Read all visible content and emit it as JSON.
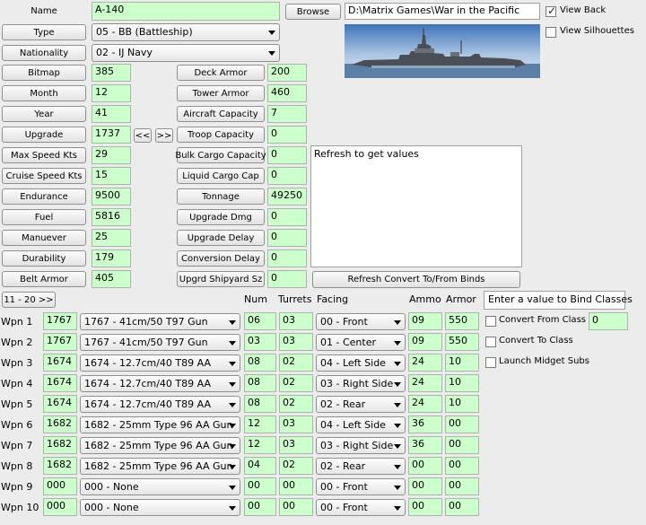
{
  "name": {
    "label": "Name",
    "value": "A-140",
    "browse": "Browse",
    "path": "D:\\Matrix Games\\War in the Pacific"
  },
  "type": {
    "label": "Type",
    "value": "05 - BB (Battleship)"
  },
  "nationality": {
    "label": "Nationality",
    "value": "02 - IJ Navy"
  },
  "view_back": {
    "label": "View Back",
    "checked": true
  },
  "view_silhouettes": {
    "label": "View Silhouettes",
    "checked": false
  },
  "left_fields": [
    {
      "label": "Bitmap",
      "value": "385"
    },
    {
      "label": "Month",
      "value": "12"
    },
    {
      "label": "Year",
      "value": "41"
    },
    {
      "label": "Upgrade",
      "value": "1737"
    },
    {
      "label": "Max Speed Kts",
      "value": "29"
    },
    {
      "label": "Cruise Speed Kts",
      "value": "15"
    },
    {
      "label": "Endurance",
      "value": "9500"
    },
    {
      "label": "Fuel",
      "value": "5816"
    },
    {
      "label": "Manuever",
      "value": "25"
    },
    {
      "label": "Durability",
      "value": "179"
    },
    {
      "label": "Belt Armor",
      "value": "405"
    }
  ],
  "upgrade_nav": {
    "prev": "<<",
    "next": ">>"
  },
  "mid_fields": [
    {
      "label": "Deck Armor",
      "value": "200"
    },
    {
      "label": "Tower Armor",
      "value": "460"
    },
    {
      "label": "Aircraft Capacity",
      "value": "7"
    },
    {
      "label": "Troop Capacity",
      "value": "0"
    },
    {
      "label": "Bulk Cargo Capacity",
      "value": "0"
    },
    {
      "label": "Liquid Cargo Cap",
      "value": "0"
    },
    {
      "label": "Tonnage",
      "value": "49250"
    },
    {
      "label": "Upgrade Dmg",
      "value": "0"
    },
    {
      "label": "Upgrade Delay",
      "value": "0"
    },
    {
      "label": "Conversion Delay",
      "value": "0"
    },
    {
      "label": "Upgrd Shipyard Sz",
      "value": "0"
    }
  ],
  "refresh_text": "Refresh to get values",
  "refresh_button": "Refresh Convert To/From Binds",
  "page_button": "11 - 20 >>",
  "headers": {
    "num": "Num",
    "turrets": "Turrets",
    "facing": "Facing",
    "ammo": "Ammo",
    "armor": "Armor"
  },
  "bind_hint": "Enter a value to Bind Classes",
  "convert_from": {
    "label": "Convert From Class",
    "value": "0"
  },
  "convert_to": {
    "label": "Convert To Class"
  },
  "launch_midget": {
    "label": "Launch Midget Subs"
  },
  "weapons": [
    {
      "label": "Wpn 1",
      "id": "1767",
      "device": "1767 - 41cm/50 T97 Gun",
      "num": "06",
      "turrets": "03",
      "facing": "00 - Front",
      "ammo": "09",
      "armor": "550"
    },
    {
      "label": "Wpn 2",
      "id": "1767",
      "device": "1767 - 41cm/50 T97 Gun",
      "num": "03",
      "turrets": "03",
      "facing": "01 - Center",
      "ammo": "09",
      "armor": "550"
    },
    {
      "label": "Wpn 3",
      "id": "1674",
      "device": "1674 - 12.7cm/40 T89 AA",
      "num": "08",
      "turrets": "02",
      "facing": "04 - Left Side",
      "ammo": "24",
      "armor": "10"
    },
    {
      "label": "Wpn 4",
      "id": "1674",
      "device": "1674 - 12.7cm/40 T89 AA",
      "num": "08",
      "turrets": "02",
      "facing": "03 - Right Side",
      "ammo": "24",
      "armor": "10"
    },
    {
      "label": "Wpn 5",
      "id": "1674",
      "device": "1674 - 12.7cm/40 T89 AA",
      "num": "08",
      "turrets": "02",
      "facing": "02 - Rear",
      "ammo": "24",
      "armor": "10"
    },
    {
      "label": "Wpn 6",
      "id": "1682",
      "device": "1682 - 25mm Type 96 AA Gun",
      "num": "12",
      "turrets": "03",
      "facing": "04 - Left Side",
      "ammo": "36",
      "armor": "00"
    },
    {
      "label": "Wpn 7",
      "id": "1682",
      "device": "1682 - 25mm Type 96 AA Gun",
      "num": "12",
      "turrets": "03",
      "facing": "03 - Right Side",
      "ammo": "36",
      "armor": "00"
    },
    {
      "label": "Wpn 8",
      "id": "1682",
      "device": "1682 - 25mm Type 96 AA Gun",
      "num": "04",
      "turrets": "02",
      "facing": "02 - Rear",
      "ammo": "00",
      "armor": "00"
    },
    {
      "label": "Wpn 9",
      "id": "000",
      "device": "000 - None",
      "num": "00",
      "turrets": "00",
      "facing": "00 - Front",
      "ammo": "00",
      "armor": "00"
    },
    {
      "label": "Wpn 10",
      "id": "000",
      "device": "000 - None",
      "num": "00",
      "turrets": "00",
      "facing": "00 - Front",
      "ammo": "00",
      "armor": "00"
    }
  ]
}
